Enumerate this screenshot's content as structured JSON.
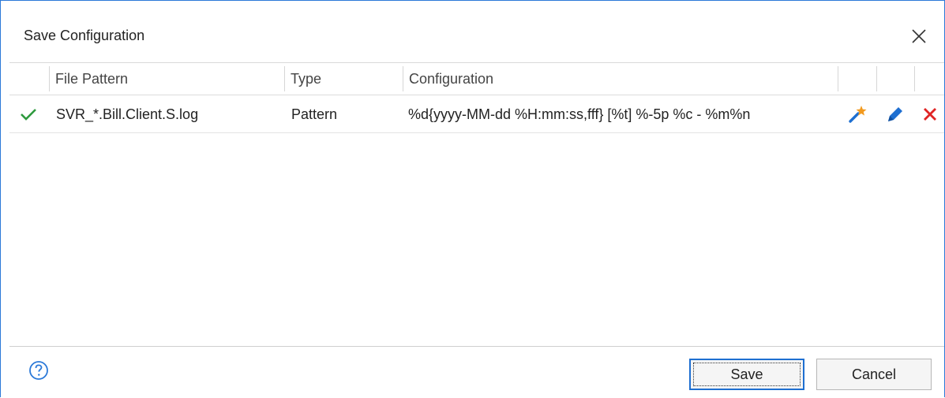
{
  "dialog": {
    "title": "Save Configuration",
    "close_icon": "close-icon"
  },
  "grid": {
    "columns": [
      "",
      "File Pattern",
      "Type",
      "Configuration",
      "",
      "",
      ""
    ],
    "rows": [
      {
        "status_icon": "check-icon",
        "file_pattern": "SVR_*.Bill.Client.S.log",
        "type": "Pattern",
        "configuration": "%d{yyyy-MM-dd %H:mm:ss,fff} [%t] %-5p %c - %m%n",
        "actions": [
          "magic-wand-icon",
          "pencil-icon",
          "delete-icon"
        ]
      }
    ]
  },
  "footer": {
    "help_icon": "help-icon",
    "save_label": "Save",
    "cancel_label": "Cancel"
  },
  "colors": {
    "accent": "#2b79d8",
    "check": "#2e9a3e",
    "delete": "#e02424",
    "edit": "#1e6fd1",
    "wand_star": "#f29a1f"
  }
}
